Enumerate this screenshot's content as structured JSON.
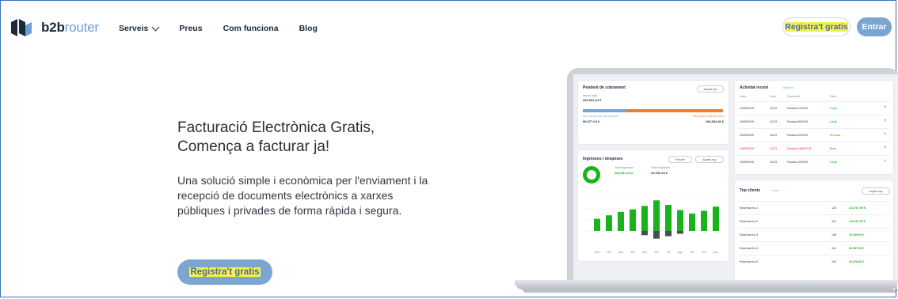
{
  "header": {
    "logo_b2b": "b2b",
    "logo_router": "router",
    "menu": [
      {
        "label": "Serveis",
        "has_dropdown": true
      },
      {
        "label": "Preus"
      },
      {
        "label": "Com funciona"
      },
      {
        "label": "Blog"
      }
    ],
    "register_label": "Registra't gratis",
    "login_label": "Entrar"
  },
  "hero": {
    "headline_1": "Facturació Electrònica Gratis,",
    "headline_2": "Comença a facturar ja!",
    "subtitle": "Una solució simple i econòmica per l'enviament i la recepció de documents electrònics a xarxes públiques i privades de forma ràpida i segura.",
    "cta_label": "Registra't gratis"
  },
  "dashboard": {
    "pending": {
      "title": "Pendent de cobrament",
      "filter": "Aquest any",
      "total_label": "Import total",
      "total": "284.931,24 €",
      "left_label": "Dins de termini (48 factures)",
      "left_value": "90.377,04 €",
      "right_label": "Vençudes (138 factures)",
      "right_value": "194.554,20 €"
    },
    "income": {
      "title": "Ingressos i despeses",
      "filter1": "Període",
      "filter2": "Aquest any",
      "in_label": "Total ingressos",
      "in_value": "284.931,24 €",
      "out_label": "Total despeses",
      "out_value": "24.931,24 €",
      "months": [
        "Gen",
        "Feb",
        "Mar",
        "Abr",
        "Mai",
        "Jun",
        "Jul",
        "Ago",
        "Set",
        "Oct",
        "Nov"
      ],
      "colors": {
        "income": "#1bb31b",
        "expense": "#4a4d52"
      }
    },
    "activity": {
      "title": "Activitat recent",
      "link": "Veure tot",
      "headers": [
        "Data",
        "Hora",
        "Document",
        "Estat"
      ],
      "rows": [
        {
          "date": "24/09/2019",
          "time": "13:23",
          "doc": "Factura 01/2019",
          "status": "Llegit",
          "status_color": "#1bb31b"
        },
        {
          "date": "24/09/2019",
          "time": "13:23",
          "doc": "Factura 08/2019",
          "status": "Llegit",
          "status_color": "#1bb31b"
        },
        {
          "date": "24/09/2019",
          "time": "13:23",
          "doc": "Factura 02/2019",
          "status": "Enviada",
          "status_color": "#1bb31b"
        },
        {
          "date": "24/09/2019",
          "time": "13:23",
          "doc": "Factura 2496/2019",
          "status": "Error",
          "status_color": "#e02424"
        },
        {
          "date": "24/09/2019",
          "time": "13:23",
          "doc": "Factura 10/2019",
          "status": "Llegit",
          "status_color": "#1bb31b"
        }
      ]
    },
    "clients": {
      "title": "Top clients",
      "link": "< Nou",
      "filter": "Aquest any",
      "rows": [
        {
          "name": "Empresa Inc.1",
          "count": "124",
          "amount": "123.767,00 €"
        },
        {
          "name": "Empresa Inc.2",
          "count": "112",
          "amount": "113.237,00 €"
        },
        {
          "name": "Empresa Inc.3",
          "count": "108",
          "amount": "78.349,00 €"
        },
        {
          "name": "Empresa Inc.4",
          "count": "104",
          "amount": "54.987,00 €"
        },
        {
          "name": "Empresa Inc.5",
          "count": "100",
          "amount": "23.678,00 €"
        }
      ]
    }
  },
  "colors": {
    "accent": "#79a5d2",
    "highlight": "#f7f04a",
    "orange": "#f07d2a"
  }
}
